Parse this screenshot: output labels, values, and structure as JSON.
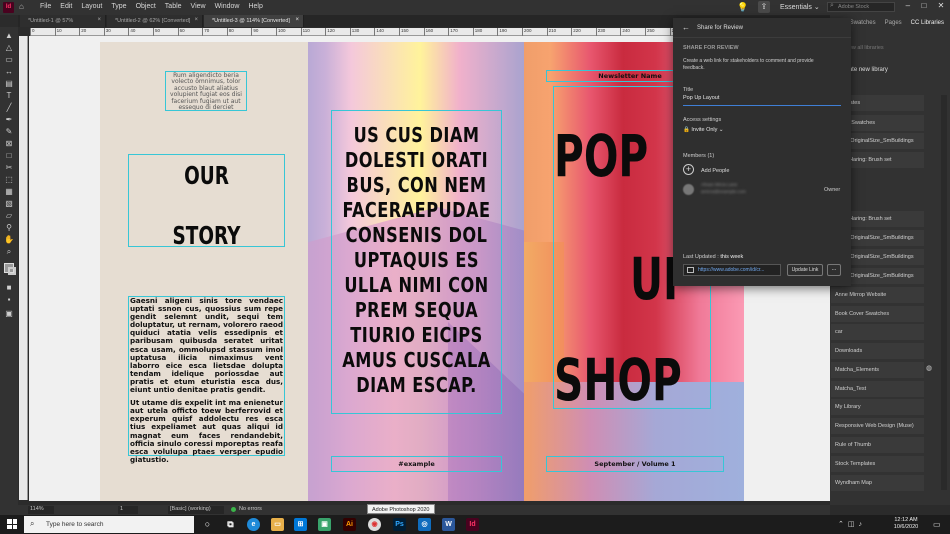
{
  "menubar": {
    "logo": "Id",
    "items": [
      "File",
      "Edit",
      "Layout",
      "Type",
      "Object",
      "Table",
      "View",
      "Window",
      "Help"
    ],
    "workspace": "Essentials",
    "search_placeholder": "Adobe Stock"
  },
  "tabs": [
    {
      "label": "*Untitled-1 @ 57%"
    },
    {
      "label": "*Untitled-2 @ 62% [Converted]"
    },
    {
      "label": "*Untitled-3 @ 114% [Converted]"
    }
  ],
  "ruler_labels": [
    "0",
    "10",
    "20",
    "30",
    "40",
    "50",
    "60",
    "70",
    "80",
    "90",
    "100",
    "110",
    "120",
    "130",
    "140",
    "150",
    "160",
    "170",
    "180",
    "190",
    "200",
    "210",
    "220",
    "230",
    "240",
    "250",
    "260",
    "270",
    "280",
    "290",
    "300",
    "310",
    "320",
    "330",
    "340",
    "350",
    "360"
  ],
  "left_page": {
    "caption": "Rum aligendicto beria volecto omnimus, tolor accusto blaut aliatius volupient fugiat eos disi facerium fugiam ut aut essequo di derciet",
    "title_line1": "OUR",
    "title_line2": "STORY",
    "body_p1": "Gaesni aligeni sinis tore vendaec uptati ssnon cus, quossius sum repe gendit selemnt undit, sequi tem doluptatur, ut rernam, volorero raeod quiduci atatia velis essedipnis et paribusam quibusda seratet uritat esca usam, ommolupsd stassum imol uptatusa ilicia nimaximus vent laborro eice esca lietsdae dolupta tendam idelique poriossdae aut pratis et etum eturistia esca dus, eiunt untio denitae pratis gendit.",
    "body_p2": "Ut utame dis expelit int ma enienetur aut utela officto toew berferrovid et experum quisf addolectu res esca tius expeliamet aut quas aliqui id magnat eum faces rendandebit, officia sinulo coressi mporeptas reafa esca volulupa ptaes versper epudio giatustio."
  },
  "mid_page": {
    "headline": "US CUS DIAM DOLESTI ORATI BUS, CON NEM FACERAEPUDAE CONSENIS DOL UPTAQUIS ES ULLA NIMI CON PREM SEQUA TIURIO EICIPS AMUS CUSCALA DIAM ESCAP.",
    "footer": "#example"
  },
  "right_page": {
    "header": "Newsletter Name",
    "word1": "POP",
    "word2": "UP",
    "word3": "SHOP",
    "footer": "September / Volume 1"
  },
  "share_panel": {
    "back_label": "Share for Review",
    "section_title": "SHARE FOR REVIEW",
    "description": "Create a web link for stakeholders to comment and provide feedback.",
    "title_label": "Title",
    "title_value": "Pop Up Layout",
    "access_label": "Access settings",
    "access_value": "Invite Only",
    "members_label": "Members (1)",
    "add_people": "Add People",
    "member_name": "Ahsan Mirza Lane",
    "member_email": "amirza@example.com",
    "member_role": "Owner",
    "last_updated_label": "Last Updated :",
    "last_updated_value": "this week",
    "link_value": "https://www.adobe.com/id/cr...",
    "update_link": "Update Link",
    "more": "..."
  },
  "right_panel": {
    "tabs": [
      "Swatches",
      "Pages",
      "CC Libraries"
    ],
    "view_all": "View all libraries",
    "create_library": "Create new library",
    "items": [
      "Templates",
      "Cover Swatches",
      "Logo_OriginalSize_SmBuildings",
      "Keith Haring: Brush set",
      "Keith Haring: Brush set",
      "Logo_OriginalSize_SmBuildings",
      "Logo_OriginalSize_SmBuildings",
      "Logo_OriginalSize_SmBuildings",
      "Anne Mirrop Website",
      "Book Cover Swatches",
      "car",
      "Downloads",
      "Matcha_Elements",
      "Matcha_Test",
      "My Library",
      "Responsive Web Design (Muse)",
      "Rule of Thumb",
      "Stock Templates",
      "Wyndham Map"
    ]
  },
  "statusbar": {
    "zoom": "114%",
    "page": "1",
    "style": "[Basic] (working)",
    "errors": "No errors"
  },
  "tooltip": "Adobe Photoshop 2020",
  "taskbar": {
    "search_placeholder": "Type here to search",
    "time": "12:12 AM",
    "date": "10/6/2020"
  }
}
